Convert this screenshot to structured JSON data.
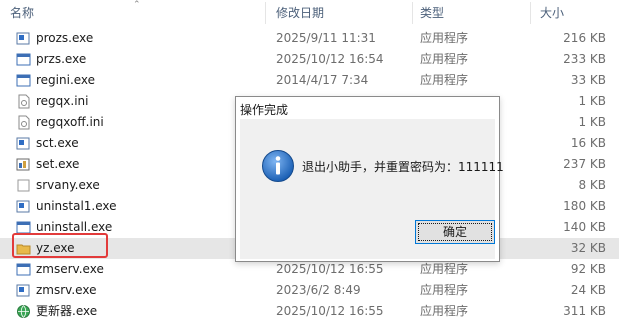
{
  "columns": {
    "name": "名称",
    "date": "修改日期",
    "type": "类型",
    "size": "大小"
  },
  "files": [
    {
      "name": "prozs.exe",
      "date": "2025/9/11 11:31",
      "type": "应用程序",
      "size": "216 KB",
      "icon": "blue-square-exe-icon"
    },
    {
      "name": "przs.exe",
      "date": "2025/10/12 16:54",
      "type": "应用程序",
      "size": "233 KB",
      "icon": "window-app-icon"
    },
    {
      "name": "regini.exe",
      "date": "2014/4/17 7:34",
      "type": "应用程序",
      "size": "33 KB",
      "icon": "window-app-icon"
    },
    {
      "name": "regqx.ini",
      "date": "",
      "type": "",
      "size": "1 KB",
      "icon": "ini-settings-icon"
    },
    {
      "name": "regqxoff.ini",
      "date": "",
      "type": "",
      "size": "1 KB",
      "icon": "ini-settings-icon"
    },
    {
      "name": "sct.exe",
      "date": "",
      "type": "",
      "size": "16 KB",
      "icon": "blue-square-exe-icon"
    },
    {
      "name": "set.exe",
      "date": "",
      "type": "",
      "size": "237 KB",
      "icon": "settings-exe-icon"
    },
    {
      "name": "srvany.exe",
      "date": "",
      "type": "",
      "size": "8 KB",
      "icon": "blank-exe-icon"
    },
    {
      "name": "uninstal1.exe",
      "date": "",
      "type": "",
      "size": "180 KB",
      "icon": "blue-square-exe-icon"
    },
    {
      "name": "uninstall.exe",
      "date": "",
      "type": "",
      "size": "140 KB",
      "icon": "window-app-icon"
    },
    {
      "name": "yz.exe",
      "date": "",
      "type": "",
      "size": "32 KB",
      "icon": "folder-exe-icon"
    },
    {
      "name": "zmserv.exe",
      "date": "2025/10/12 16:55",
      "type": "应用程序",
      "size": "92 KB",
      "icon": "window-app-icon"
    },
    {
      "name": "zmsrv.exe",
      "date": "2023/6/2 8:49",
      "type": "应用程序",
      "size": "24 KB",
      "icon": "blue-square-exe-icon"
    },
    {
      "name": "更新器.exe",
      "date": "2025/10/12 16:55",
      "type": "应用程序",
      "size": "311 KB",
      "icon": "globe-exe-icon"
    }
  ],
  "dialog": {
    "title": "操作完成",
    "message": "退出小助手，并重置密码为：111111",
    "ok_label": "确定",
    "icon": "info-icon"
  },
  "colors": {
    "highlight_border": "#e23b3b",
    "selected_row": "#e6e6e6",
    "dialog_body": "#f0f0f0",
    "button_focus": "#0078d7"
  }
}
